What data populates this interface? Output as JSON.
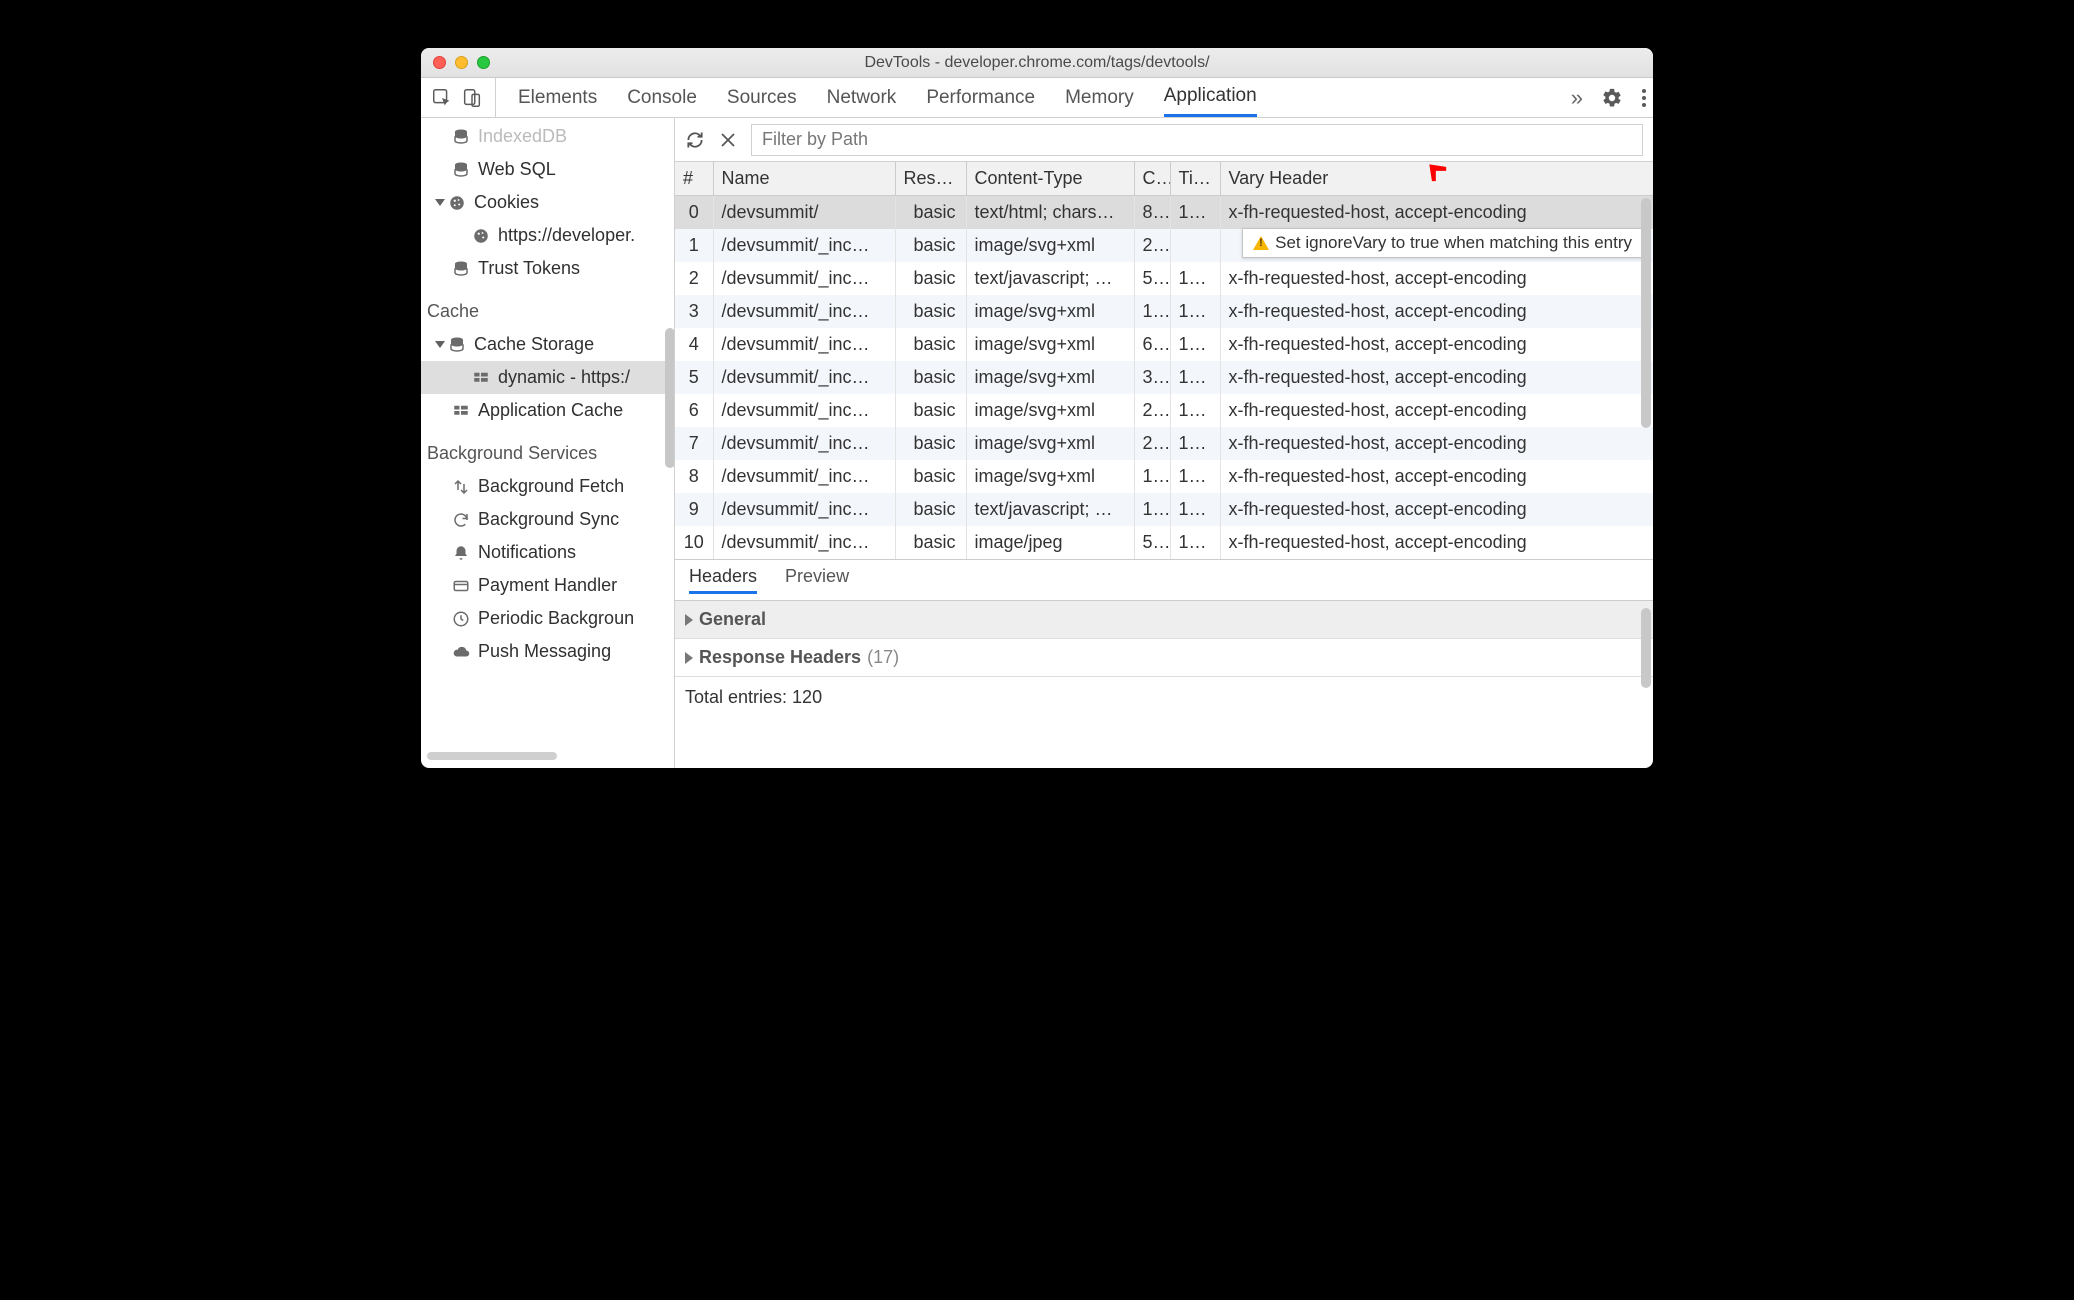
{
  "window": {
    "title": "DevTools - developer.chrome.com/tags/devtools/"
  },
  "tabs": {
    "items": [
      "Elements",
      "Console",
      "Sources",
      "Network",
      "Performance",
      "Memory",
      "Application"
    ],
    "active": "Application",
    "more": "»"
  },
  "sidebar": {
    "truncated_top": "IndexedDB",
    "web_sql": "Web SQL",
    "cookies": "Cookies",
    "cookies_child": "https://developer.",
    "trust_tokens": "Trust Tokens",
    "cache_header": "Cache",
    "cache_storage": "Cache Storage",
    "cache_item": "dynamic - https:/",
    "app_cache": "Application Cache",
    "bg_header": "Background Services",
    "bg_fetch": "Background Fetch",
    "bg_sync": "Background Sync",
    "notifications": "Notifications",
    "payment": "Payment Handler",
    "periodic": "Periodic Backgroun",
    "push": "Push Messaging"
  },
  "toolbar": {
    "filter_placeholder": "Filter by Path"
  },
  "table": {
    "headers": {
      "idx": "#",
      "name": "Name",
      "res": "Res…",
      "type": "Content-Type",
      "len": "C..",
      "time": "Ti…",
      "vary": "Vary Header"
    },
    "rows": [
      {
        "idx": "0",
        "name": "/devsummit/",
        "res": "basic",
        "type": "text/html; chars…",
        "len": "8…",
        "time": "1…",
        "vary": "x-fh-requested-host, accept-encoding",
        "sel": true
      },
      {
        "idx": "1",
        "name": "/devsummit/_inc…",
        "res": "basic",
        "type": "image/svg+xml",
        "len": "2…",
        "time": "",
        "vary": ""
      },
      {
        "idx": "2",
        "name": "/devsummit/_inc…",
        "res": "basic",
        "type": "text/javascript; …",
        "len": "5…",
        "time": "1…",
        "vary": "x-fh-requested-host, accept-encoding"
      },
      {
        "idx": "3",
        "name": "/devsummit/_inc…",
        "res": "basic",
        "type": "image/svg+xml",
        "len": "1…",
        "time": "1…",
        "vary": "x-fh-requested-host, accept-encoding"
      },
      {
        "idx": "4",
        "name": "/devsummit/_inc…",
        "res": "basic",
        "type": "image/svg+xml",
        "len": "6…",
        "time": "1…",
        "vary": "x-fh-requested-host, accept-encoding"
      },
      {
        "idx": "5",
        "name": "/devsummit/_inc…",
        "res": "basic",
        "type": "image/svg+xml",
        "len": "3…",
        "time": "1…",
        "vary": "x-fh-requested-host, accept-encoding"
      },
      {
        "idx": "6",
        "name": "/devsummit/_inc…",
        "res": "basic",
        "type": "image/svg+xml",
        "len": "2…",
        "time": "1…",
        "vary": "x-fh-requested-host, accept-encoding"
      },
      {
        "idx": "7",
        "name": "/devsummit/_inc…",
        "res": "basic",
        "type": "image/svg+xml",
        "len": "2…",
        "time": "1…",
        "vary": "x-fh-requested-host, accept-encoding"
      },
      {
        "idx": "8",
        "name": "/devsummit/_inc…",
        "res": "basic",
        "type": "image/svg+xml",
        "len": "1…",
        "time": "1…",
        "vary": "x-fh-requested-host, accept-encoding"
      },
      {
        "idx": "9",
        "name": "/devsummit/_inc…",
        "res": "basic",
        "type": "text/javascript; …",
        "len": "1…",
        "time": "1…",
        "vary": "x-fh-requested-host, accept-encoding"
      },
      {
        "idx": "10",
        "name": "/devsummit/_inc…",
        "res": "basic",
        "type": "image/jpeg",
        "len": "5…",
        "time": "1…",
        "vary": "x-fh-requested-host, accept-encoding"
      }
    ]
  },
  "tooltip": "Set ignoreVary to true when matching this entry",
  "detail": {
    "tabs": {
      "headers": "Headers",
      "preview": "Preview"
    },
    "general": "General",
    "response_headers": "Response Headers",
    "response_count": "(17)",
    "total": "Total entries: 120"
  }
}
